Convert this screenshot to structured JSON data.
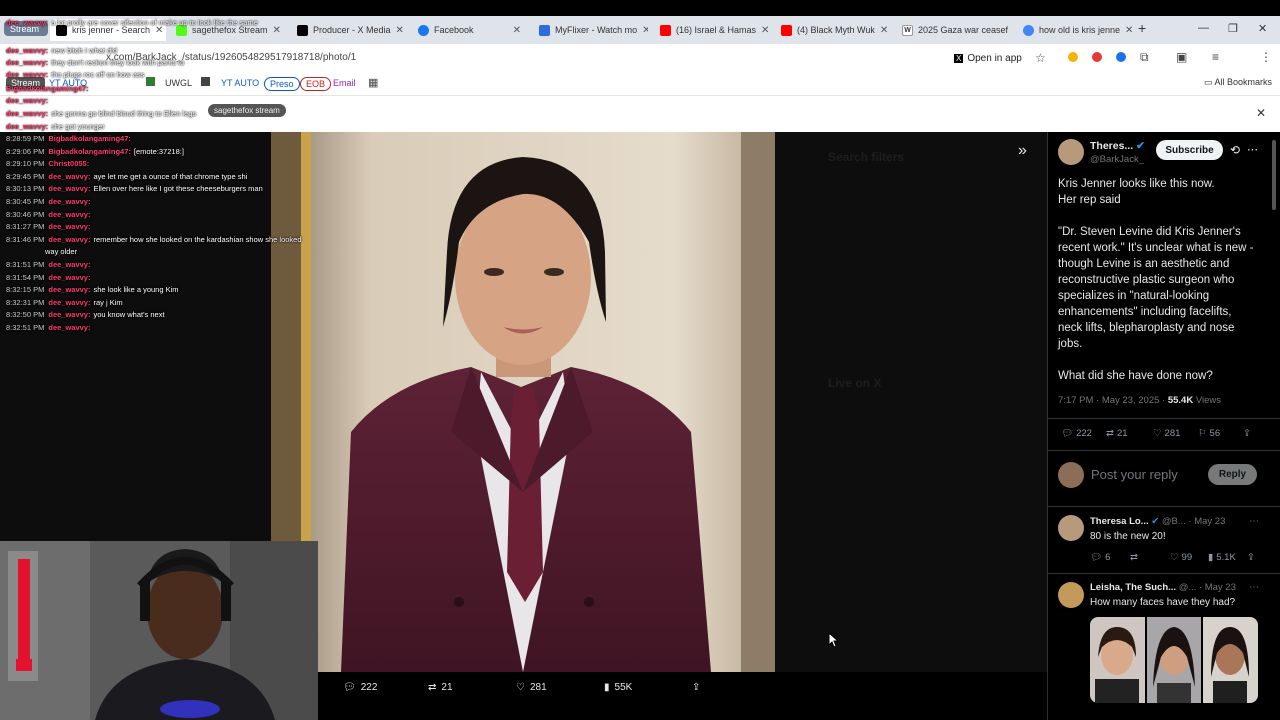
{
  "browser": {
    "tabs": [
      {
        "label": "Stream",
        "color": "#6b7c93"
      },
      {
        "label": "kris jenner - Search",
        "color": "#000000",
        "active": true
      },
      {
        "label": "sagethefox Stream",
        "color": "#53fc18"
      },
      {
        "label": "Producer - X Media",
        "color": "#000000"
      },
      {
        "label": "Facebook",
        "color": "#1877f2"
      },
      {
        "label": "MyFlixer - Watch mo",
        "color": "#2d6cdf"
      },
      {
        "label": "(16) Israel & Hamas",
        "color": "#ff0000"
      },
      {
        "label": "(4) Black Myth Wuk",
        "color": "#ff0000"
      },
      {
        "label": "2025 Gaza war ceasef",
        "color": "#ffffff"
      },
      {
        "label": "how old is kris jenne",
        "color": "#4285f4"
      }
    ],
    "new_tab": "+",
    "url": "x.com/BarkJack_/status/1926054829517918718/photo/1",
    "open_in_app": "Open in app",
    "bookmarks": [
      {
        "label": "Stream",
        "color": "#555"
      },
      {
        "label": "YT AUTO",
        "color": "#0b57d0"
      },
      {
        "label": "UWGL",
        "color": "#333"
      },
      {
        "label": "YT AUTO",
        "color": "#0b57d0"
      },
      {
        "label": "Preso",
        "color": "#0b57d0"
      },
      {
        "label": "EOB",
        "color": "#c5221f"
      },
      {
        "label": "Email",
        "color": "#9c27b0"
      }
    ],
    "all_bookmarks": "All Bookmarks",
    "info_pill": "sagethefox stream"
  },
  "photo_actions": {
    "replies": "222",
    "reposts": "21",
    "likes": "281",
    "views": "55K"
  },
  "tweet": {
    "author_name": "Theres...",
    "author_handle": "@BarkJack_",
    "subscribe": "Subscribe",
    "body": "Kris Jenner looks like this now.\nHer rep said\n\n\"Dr. Steven Levine did Kris Jenner's recent work.\" It's unclear what is new - though Levine is an aesthetic and reconstructive plastic surgeon who specializes in \"natural-looking enhancements\" including facelifts, neck lifts, blepharoplasty and nose jobs.\n\nWhat did she have done now?",
    "meta_time": "7:17 PM · May 23, 2025 · ",
    "meta_views": "55.4K",
    "meta_views_label": " Views",
    "replies": "222",
    "reposts": "21",
    "likes": "281",
    "bookmarks": "56",
    "reply_placeholder": "Post your reply",
    "reply_button": "Reply"
  },
  "replies": [
    {
      "name": "Theresa Lo...",
      "handle": "@B...",
      "date": "· May 23",
      "text": "80 is the new 20!",
      "replies": "6",
      "reposts": "",
      "likes": "99",
      "views": "5.1K"
    },
    {
      "name": "Leisha, The Such...",
      "handle": "@...",
      "date": "· May 23",
      "text": "How many faces have they had?"
    }
  ],
  "chat": [
    {
      "time": "8:28:59 PM",
      "user": "Bigbadkolangaming47:",
      "msg": ""
    },
    {
      "time": "8:29:06 PM",
      "user": "Bigbadkolangaming47:",
      "msg": "[emote:37218:]"
    },
    {
      "time": "8:29:10 PM",
      "user": "Christ0055:",
      "msg": ""
    },
    {
      "time": "8:29:45 PM",
      "user": "dee_wavvy:",
      "msg": "aye let me get a ounce of that chrome type shi"
    },
    {
      "time": "8:30:13 PM",
      "user": "dee_wavvy:",
      "msg": "Ellen over here like I got these cheeseburgers man"
    },
    {
      "time": "8:30:45 PM",
      "user": "dee_wavvy:",
      "msg": ""
    },
    {
      "time": "8:30:46 PM",
      "user": "dee_wavvy:",
      "msg": ""
    },
    {
      "time": "8:31:27 PM",
      "user": "dee_wavvy:",
      "msg": ""
    },
    {
      "time": "8:31:46 PM",
      "user": "dee_wavvy:",
      "msg": "remember how she looked on the kardashian show she looked"
    },
    {
      "time": "",
      "user": "",
      "msg": "way older"
    },
    {
      "time": "8:31:51 PM",
      "user": "dee_wavvy:",
      "msg": ""
    },
    {
      "time": "8:31:54 PM",
      "user": "dee_wavvy:",
      "msg": ""
    },
    {
      "time": "8:32:15 PM",
      "user": "dee_wavvy:",
      "msg": "she look like a young Kim"
    },
    {
      "time": "8:32:31 PM",
      "user": "dee_wavvy:",
      "msg": "ray j Kim"
    },
    {
      "time": "8:32:50 PM",
      "user": "dee_wavvy:",
      "msg": "you know what's next"
    },
    {
      "time": "8:32:51 PM",
      "user": "dee_wavvy:",
      "msg": ""
    }
  ],
  "chat_top": [
    {
      "user": "dee_wavvy:",
      "msg": "a lot prolly are cover sifection of make up to look like the same"
    },
    {
      "user": "dee_wavvy:",
      "msg": "new bitch I what did"
    },
    {
      "user": "dee_wavvy:",
      "msg": "they don't reckon they look with pants to"
    },
    {
      "user": "dee_wavvy:",
      "msg": "tho plugs roc off on how ass"
    },
    {
      "user": "Bigbadkolangaming47:",
      "msg": ""
    },
    {
      "user": "dee_wavvy:",
      "msg": ""
    },
    {
      "user": "dee_wavvy:",
      "msg": "she gonna go blind bloud thing to Ellen legs"
    },
    {
      "user": "dee_wavvy:",
      "msg": "she got younger"
    }
  ]
}
